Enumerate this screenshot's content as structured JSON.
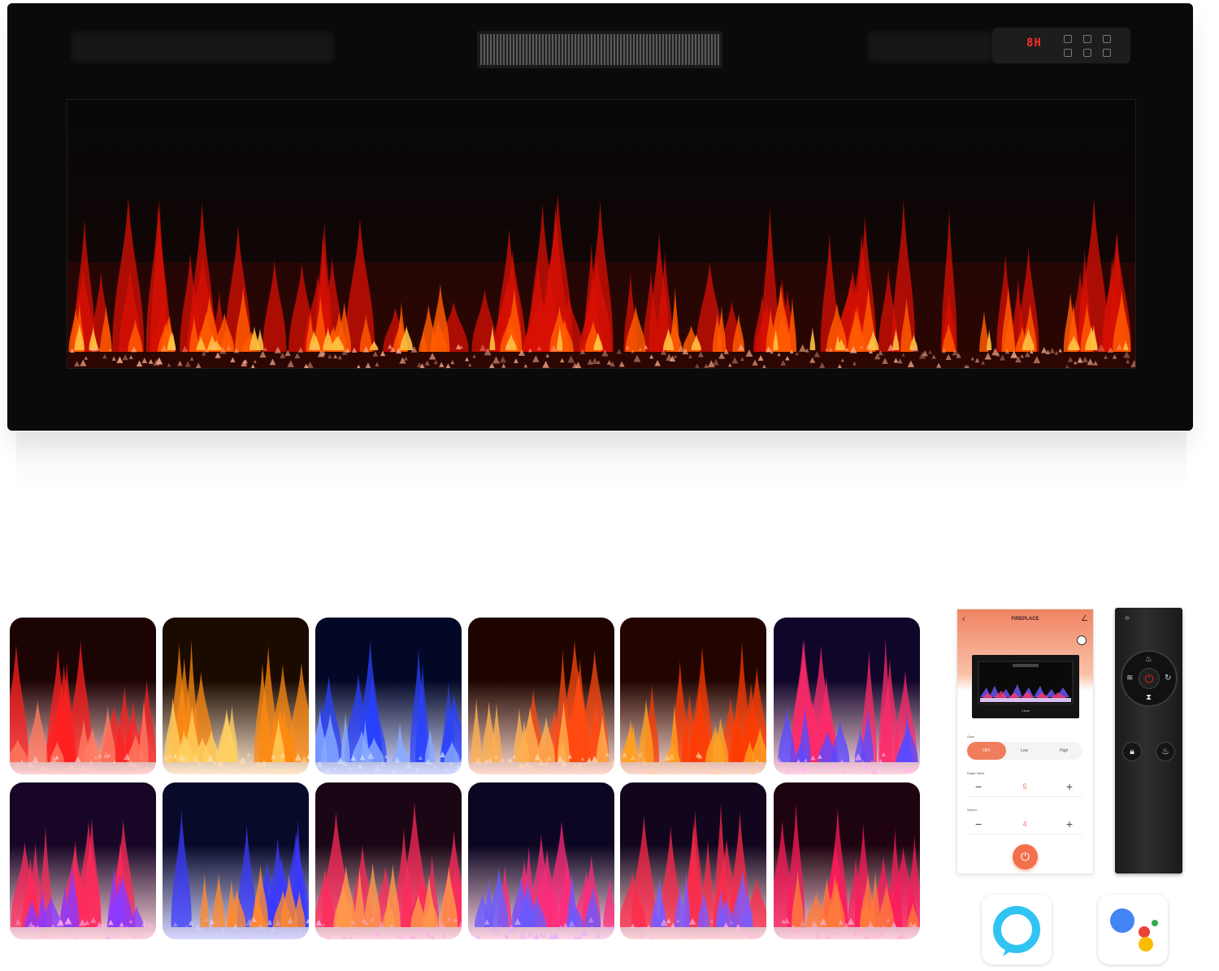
{
  "control_panel": {
    "display": "8H"
  },
  "phone_app": {
    "title": "FIREPLACE",
    "gear_label": "Gear",
    "gear_options": [
      "OFF",
      "Low",
      "High"
    ],
    "bright_label": "Bright Value",
    "bright_value": "5",
    "speed_label": "Speed",
    "speed_value": "4",
    "screen_caption": "Close"
  },
  "colors": {
    "accent": "#f07d5c",
    "flame_red": "#ff2a10",
    "flame_orange": "#ff9a1a",
    "flame_blue": "#2a46ff",
    "flame_purple": "#c02aff",
    "flame_pink": "#ff2a8a"
  },
  "flame_presets": [
    {
      "name": "red",
      "base": "#1c0304",
      "flame": "#ff2020",
      "tip": "#ff7b60",
      "bed": "#ffd0c8"
    },
    {
      "name": "orange",
      "base": "#1a0a00",
      "flame": "#ff8a10",
      "tip": "#ffcf60",
      "bed": "#ffe0b0"
    },
    {
      "name": "blue",
      "base": "#030826",
      "flame": "#2840ff",
      "tip": "#88aaff",
      "bed": "#d0e0ff"
    },
    {
      "name": "orange-red",
      "base": "#1e0500",
      "flame": "#ff4a10",
      "tip": "#ffb050",
      "bed": "#ffd8b8"
    },
    {
      "name": "amber-red",
      "base": "#220400",
      "flame": "#ff3a00",
      "tip": "#ffa020",
      "bed": "#ffd090"
    },
    {
      "name": "blue-pink",
      "base": "#10062a",
      "flame": "#ff2a6a",
      "tip": "#5a4aff",
      "bed": "#ffb0f0"
    },
    {
      "name": "purple-red",
      "base": "#180626",
      "flame": "#ff2a5a",
      "tip": "#8a3aff",
      "bed": "#ffb0f0"
    },
    {
      "name": "blue-orange",
      "base": "#080a2a",
      "flame": "#3a3aff",
      "tip": "#ff8a30",
      "bed": "#d8c8ff"
    },
    {
      "name": "pink-orange",
      "base": "#1a0614",
      "flame": "#ff2a5a",
      "tip": "#ff9a4a",
      "bed": "#ffb0e8"
    },
    {
      "name": "blue-magenta",
      "base": "#0c0622",
      "flame": "#ff2a7a",
      "tip": "#6a5aff",
      "bed": "#e0b0ff"
    },
    {
      "name": "multi",
      "base": "#12061e",
      "flame": "#ff2a4a",
      "tip": "#7a5aff",
      "bed": "#ffb8e0"
    },
    {
      "name": "magenta-red",
      "base": "#1e0410",
      "flame": "#ff1a5a",
      "tip": "#ff7a3a",
      "bed": "#ffb0d0"
    }
  ],
  "assistants": [
    {
      "name": "Alexa",
      "icon": "alexa-ring-icon",
      "color": "#31c4f3"
    },
    {
      "name": "Google Assistant",
      "icon": "google-assistant-icon",
      "colors": [
        "#4285f4",
        "#ea4335",
        "#fbbc05",
        "#34a853"
      ]
    }
  ]
}
